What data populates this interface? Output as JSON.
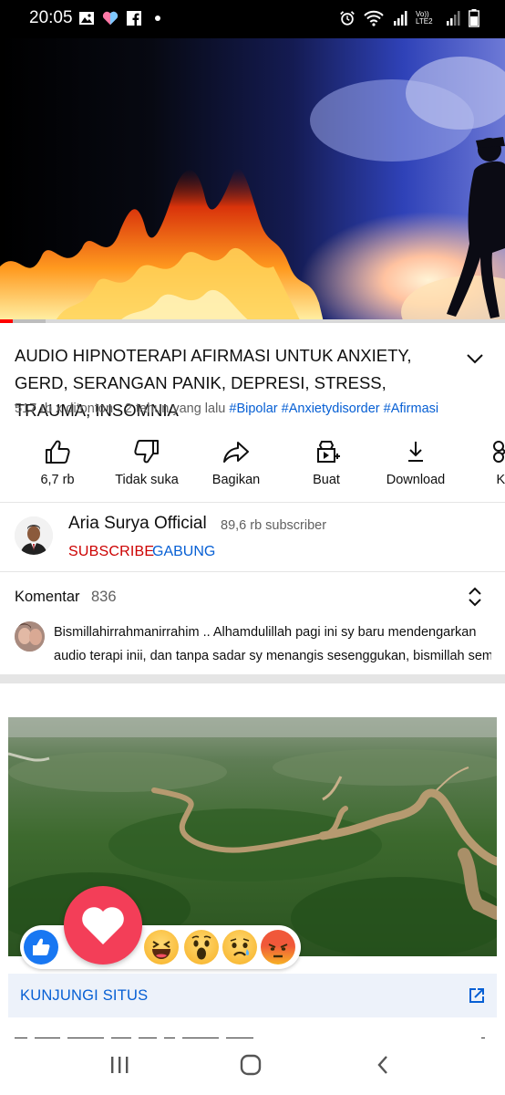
{
  "status_bar": {
    "time": "20:05",
    "left_icons": [
      "image-icon",
      "heart-icon",
      "facebook-icon",
      "dot-icon"
    ],
    "right_icons": [
      "alarm-icon",
      "wifi-icon",
      "signal-icon",
      "volte-icon",
      "signal-icon",
      "battery-icon"
    ],
    "volte_label": "Vo)) LTE2"
  },
  "video": {
    "progress_fraction": 0.025,
    "buffer_fraction": 0.09
  },
  "title": "AUDIO HIPNOTERAPI AFIRMASI UNTUK ANXIETY, GERD, SERANGAN PANIK, DEPRESI, STRESS, TRAUMA, INSOMNIA",
  "meta": {
    "views": "517 rb x ditonton",
    "separator": " · ",
    "age": "2 tahun yang lalu",
    "hashtags": [
      "#Bipolar",
      "#Anxietydisorder",
      "#Afirmasi"
    ]
  },
  "actions": [
    {
      "icon": "thumbs-up-icon",
      "label": "6,7 rb"
    },
    {
      "icon": "thumbs-down-icon",
      "label": "Tidak suka"
    },
    {
      "icon": "share-icon",
      "label": "Bagikan"
    },
    {
      "icon": "create-icon",
      "label": "Buat"
    },
    {
      "icon": "download-icon",
      "label": "Download"
    },
    {
      "icon": "clip-icon",
      "label": "Kl"
    }
  ],
  "channel": {
    "name": "Aria Surya Official",
    "subscribers": "89,6 rb subscriber",
    "subscribe_label": "SUBSCRIBE",
    "join_label": "GABUNG"
  },
  "comments": {
    "label": "Komentar",
    "count": "836",
    "top_comment_line1": "Bismillahirrahmanirrahim .. Alhamdulillah pagi ini sy baru mendengarkan",
    "top_comment_line2": "audio terapi inii, dan tanpa sadar sy menangis sesenggukan, bismillah sem..."
  },
  "ad": {
    "reactions": [
      "like",
      "love",
      "haha",
      "wow",
      "sad",
      "angry"
    ],
    "cta_label": "KUNJUNGI SITUS",
    "cta_icon": "open-external-icon"
  },
  "navbar": {
    "buttons": [
      "recent-apps-icon",
      "home-icon",
      "back-icon"
    ]
  },
  "colors": {
    "link_blue": "#065fd4",
    "subscribe_red": "#cc0000",
    "progress_red": "#ff0000",
    "secondary_text": "#606060"
  }
}
